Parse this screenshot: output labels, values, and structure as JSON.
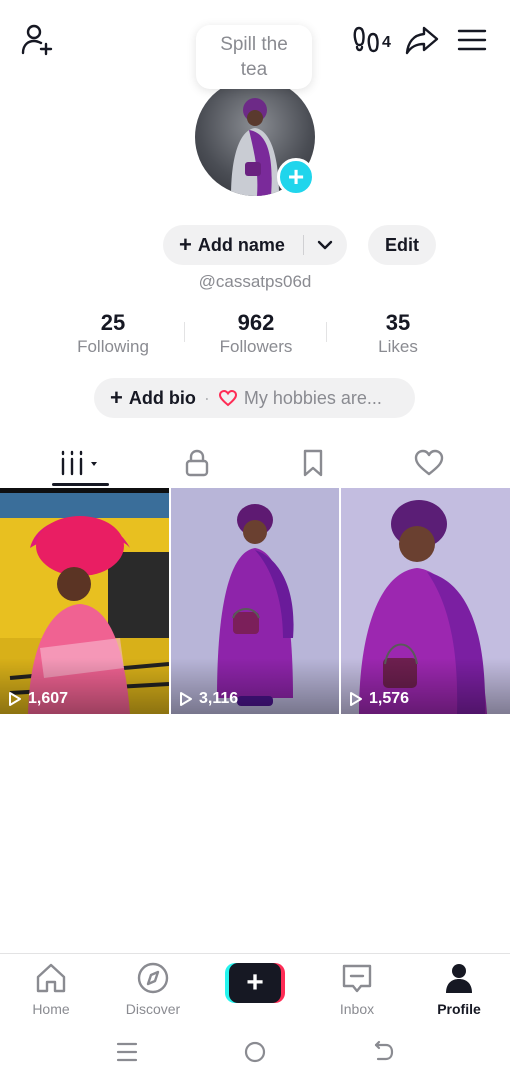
{
  "tooltip": {
    "text": "Spill the tea"
  },
  "profile": {
    "add_name_label": "Add name",
    "edit_label": "Edit",
    "username": "@cassatps06d",
    "badge_count": "4"
  },
  "stats": [
    {
      "value": "25",
      "label": "Following"
    },
    {
      "value": "962",
      "label": "Followers"
    },
    {
      "value": "35",
      "label": "Likes"
    }
  ],
  "bio": {
    "add_label": "Add bio",
    "placeholder": "My hobbies are..."
  },
  "tabs": [
    {
      "icon": "grid-videos-icon",
      "active": true
    },
    {
      "icon": "lock-icon",
      "active": false
    },
    {
      "icon": "bookmark-icon",
      "active": false
    },
    {
      "icon": "heart-icon",
      "active": false
    }
  ],
  "videos": [
    {
      "views": "1,607"
    },
    {
      "views": "3,116"
    },
    {
      "views": "1,576"
    }
  ],
  "nav": [
    {
      "label": "Home",
      "icon": "home-icon"
    },
    {
      "label": "Discover",
      "icon": "compass-icon"
    },
    {
      "label": "",
      "icon": "create-plus-icon"
    },
    {
      "label": "Inbox",
      "icon": "inbox-icon"
    },
    {
      "label": "Profile",
      "icon": "profile-icon",
      "active": true
    }
  ],
  "colors": {
    "accent_cyan": "#20d5ec",
    "accent_pink": "#fe2c55",
    "text_primary": "#161823",
    "text_secondary": "#8a8b91"
  }
}
